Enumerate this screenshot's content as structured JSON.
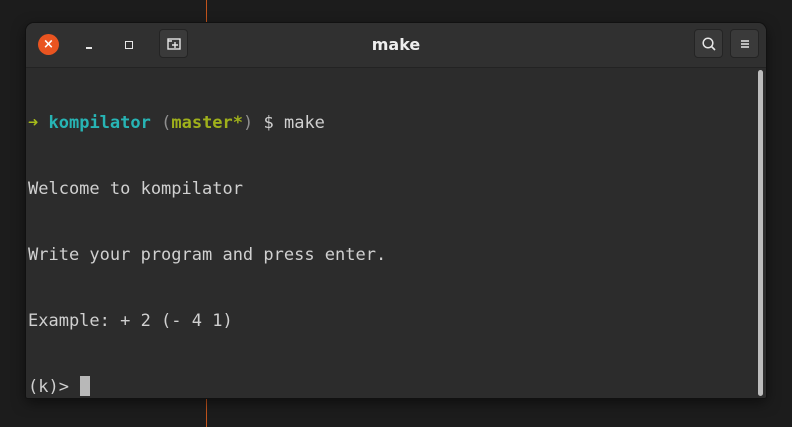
{
  "window": {
    "title": "make",
    "close_glyph": "×"
  },
  "terminal": {
    "prompt": {
      "arrow": "➜",
      "directory": "kompilator",
      "paren_open": "(",
      "branch": "master*",
      "paren_close": ")",
      "dollar_command": " $ make"
    },
    "output_lines": [
      "Welcome to kompilator",
      "Write your program and press enter.",
      "Example: + 2 (- 4 1)"
    ],
    "input_prompt": "(k)> ",
    "input_value": ""
  },
  "icons": {
    "close": "close-icon",
    "minimize": "minimize-icon",
    "maximize": "maximize-icon",
    "new_tab": "new-tab-icon",
    "search": "search-icon",
    "menu": "hamburger-menu-icon"
  },
  "colors": {
    "close_button": "#e95420",
    "prompt_arrow": "#a6bc1a",
    "prompt_directory": "#27b4b4",
    "prompt_branch": "#9fb01b",
    "terminal_bg": "#2c2c2c",
    "terminal_text": "#d0d0d0",
    "desktop_accent": "#c2541c"
  }
}
